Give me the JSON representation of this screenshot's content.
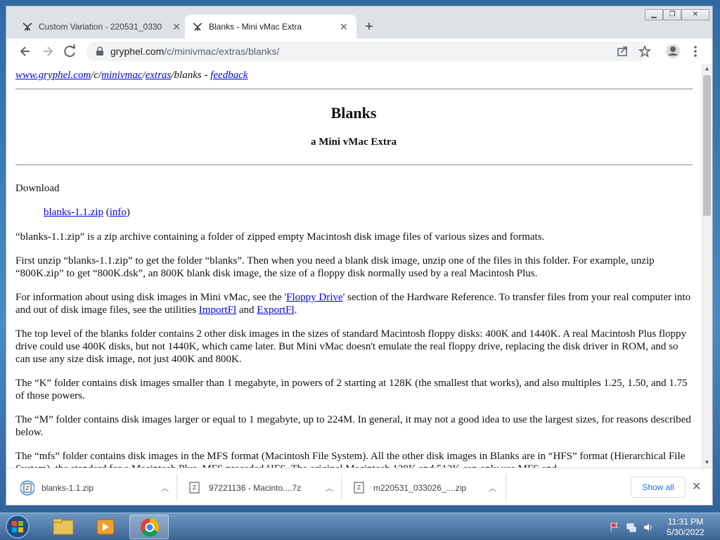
{
  "tabs": [
    {
      "title": "Custom Variation - 220531_0330",
      "active": false
    },
    {
      "title": "Blanks - Mini vMac Extra",
      "active": true
    }
  ],
  "address": {
    "host": "gryphel.com",
    "path": "/c/minivmac/extras/blanks/"
  },
  "page": {
    "crumbs": {
      "site": "www.gryphel.com",
      "sep1": "/c/",
      "minivmac": "minivmac",
      "sep2": "/",
      "extras": "extras",
      "rest": "/blanks - ",
      "feedback": "feedback"
    },
    "title": "Blanks",
    "subtitle": "a Mini vMac Extra",
    "download_label": "Download",
    "download_link": "blanks-1.1.zip",
    "info_link": "info",
    "p1": "“blanks-1.1.zip” is a zip archive containing a folder of zipped empty Macintosh disk image files of various sizes and formats.",
    "p2": "First unzip “blanks-1.1.zip” to get the folder “blanks”. Then when you need a blank disk image, unzip one of the files in this folder. For example, unzip “800K.zip” to get “800K.dsk”, an 800K blank disk image, the size of a floppy disk normally used by a real Macintosh Plus.",
    "p3a": "For information about using disk images in Mini vMac, see the '",
    "p3_link1": "Floppy Drive",
    "p3b": "' section of the Hardware Reference. To transfer files from your real computer into and out of disk image files, see the utilities ",
    "p3_link2": "ImportFl",
    "p3c": " and ",
    "p3_link3": "ExportFl",
    "p3d": ".",
    "p4": "The top level of the blanks folder contains 2 other disk images in the sizes of standard Macintosh floppy disks: 400K and 1440K. A real Macintosh Plus floppy drive could use 400K disks, but not 1440K, which came later. But Mini vMac doesn't emulate the real floppy drive, replacing the disk driver in ROM, and so can use any size disk image, not just 400K and 800K.",
    "p5": "The “K” folder contains disk images smaller than 1 megabyte, in powers of 2 starting at 128K (the smallest that works), and also multiples 1.25, 1.50, and 1.75 of those powers.",
    "p6": "The “M” folder contains disk images larger or equal to 1 megabyte, up to 224M. In general, it may not a good idea to use the largest sizes, for reasons described below.",
    "p7": "The “mfs” folder contains disk images in the MFS format (Macintosh File System). All the other disk images in Blanks are in “HFS” format (Hierarchical File System), the standard for a Macintosh Plus. MFS preceded HFS. The original Macintosh 128K and 512K can only use MFS and"
  },
  "downloads": [
    {
      "name": "blanks-1.1.zip"
    },
    {
      "name": "97221136 - Macinto....7z"
    },
    {
      "name": "m220531_033026_....zip"
    }
  ],
  "show_all": "Show all",
  "clock": {
    "time": "11:31 PM",
    "date": "5/30/2022"
  }
}
